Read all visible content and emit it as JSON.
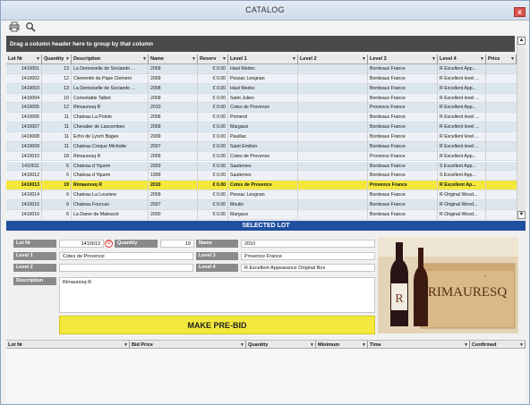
{
  "window": {
    "title": "CATALOG",
    "close_glyph": "x"
  },
  "toolbar": {
    "icons": [
      "print-icon",
      "search-icon"
    ]
  },
  "groupbar": {
    "text": "Drag a column header here to group by that column"
  },
  "grid": {
    "columns": [
      "Lot Nr",
      "Quantity",
      "Description",
      "Name",
      "Reserv",
      "Level 1",
      "Level 2",
      "Level 3",
      "Level 4",
      "Price"
    ],
    "rows": [
      [
        "1410001",
        "13",
        "La Demoiselle de Sociando ...",
        "2009",
        "€ 0.00",
        "Haut Medoc",
        "",
        "Bordeaux France",
        "R Excellent App..."
      ],
      [
        "1410002",
        "12",
        "Clementin du Pape Clement",
        "2009",
        "€ 0.00",
        "Pessac Leognan",
        "",
        "Bordeaux France",
        "R Excellent level ..."
      ],
      [
        "1410003",
        "13",
        "La Demoiselle de Sociando ...",
        "2008",
        "€ 0.00",
        "Haut Medoc",
        "",
        "Bordeaux France",
        "R Excellent App..."
      ],
      [
        "1410004",
        "10",
        "Connetable Talbot",
        "2009",
        "€ 0.00",
        "Saint Julien",
        "",
        "Bordeaux France",
        "R Excellent level ..."
      ],
      [
        "1410005",
        "12",
        "Rimauresq R",
        "2010",
        "€ 0.00",
        "Cotes de Provence",
        "",
        "Provence France",
        "R Excellent App..."
      ],
      [
        "1410006",
        "11",
        "Chateau La Pointe",
        "2006",
        "€ 0.00",
        "Pomerol",
        "",
        "Bordeaux France",
        "R Excellent level ..."
      ],
      [
        "1410007",
        "11",
        "Chevalier de Lascombes",
        "2009",
        "€ 0.00",
        "Margaux",
        "",
        "Bordeaux France",
        "R Excellent level ..."
      ],
      [
        "1410008",
        "11",
        "Echo de Lynch Bages",
        "2009",
        "€ 0.00",
        "Pauillac",
        "",
        "Bordeaux France",
        "R Excellent level ..."
      ],
      [
        "1410009",
        "11",
        "Chateau Croque Michotte",
        "2007",
        "€ 0.00",
        "Saint Emilion",
        "",
        "Bordeaux France",
        "R Excellent level ..."
      ],
      [
        "1410010",
        "18",
        "Rimauresq R",
        "2009",
        "€ 0.00",
        "Cotes de Provence",
        "",
        "Provence France",
        "R Excellent App..."
      ],
      [
        "1410011",
        "6",
        "Chateau d Yquem",
        "2003",
        "€ 0.00",
        "Sauternes",
        "",
        "Bordeaux France",
        "S Excellent App..."
      ],
      [
        "1410012",
        "6",
        "Chateau d Yquem",
        "1999",
        "€ 0.00",
        "Sauternes",
        "",
        "Bordeaux France",
        "S Excellent App..."
      ],
      [
        "1410013",
        "19",
        "Rimauresq R",
        "2010",
        "€ 0.00",
        "Cotes de Provence",
        "",
        "Provence France",
        "R Excellent Ap..."
      ],
      [
        "1410014",
        "6",
        "Chateau La Louviere",
        "2009",
        "€ 0.00",
        "Pessac Leognan",
        "",
        "Bordeaux France",
        "R Original Wood..."
      ],
      [
        "1410015",
        "6",
        "Chateau Fourcas",
        "2007",
        "€ 0.00",
        "Moulis",
        "",
        "Bordeaux France",
        "R Original Wood..."
      ],
      [
        "1410016",
        "6",
        "La Dame de Malescot",
        "2000",
        "€ 0.00",
        "Margaux",
        "",
        "Bordeaux France",
        "R Original Wood..."
      ]
    ],
    "selected_index": 12
  },
  "selected_lot": {
    "header": "SELECTED LOT",
    "lot_nr_label": "Lot Nr",
    "lot_nr": "1410013",
    "quantity_label": "Quantity",
    "quantity": "19",
    "name_label": "Name",
    "name": "2010",
    "level1_label": "Level 1",
    "level1": "Cotes de Provence",
    "level2_label": "Level 2",
    "level2": "",
    "level3_label": "Level 3",
    "level3": "Provence France",
    "level4_label": "Level 4",
    "level4": "R Excellent Appearance Original Box",
    "description_label": "Description",
    "description": "Rimauresq R",
    "prebid_label": "MAKE PRE-BID",
    "photo_brand": "RIMAURESQ",
    "photo_bottle_letter": "R"
  },
  "bids": {
    "columns": [
      "Lot Nr",
      "Bid Price",
      "Quantity",
      "Minimum",
      "Time",
      "Confirmed"
    ]
  },
  "colors": {
    "selected_row": "#f5e83c",
    "header_blue": "#1f4f9f",
    "group_bar": "#4a4a4a"
  }
}
